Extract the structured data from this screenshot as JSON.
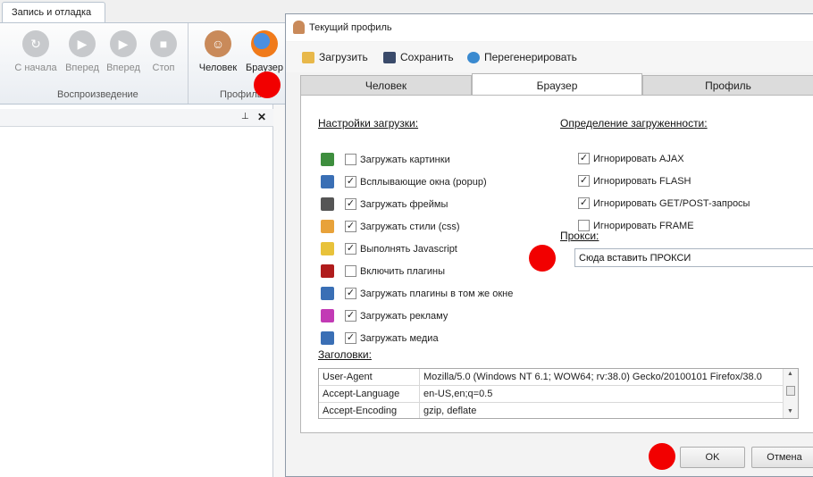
{
  "app": {
    "ribbon_tab": "Запись и отладка",
    "buttons": [
      {
        "label": "С начала",
        "icon": "restart-icon"
      },
      {
        "label": "Вперед",
        "icon": "play-icon"
      },
      {
        "label": "Вперед",
        "icon": "step-forward-icon"
      },
      {
        "label": "Стоп",
        "icon": "stop-icon"
      },
      {
        "label": "Человек",
        "icon": "person-icon"
      },
      {
        "label": "Браузер",
        "icon": "firefox-icon"
      }
    ],
    "group_playback": "Воспроизведение",
    "group_profile": "Профиль",
    "panel_pin": "⊥",
    "panel_close": "✕"
  },
  "dialog": {
    "title": "Текущий профиль",
    "toolbar": {
      "load": "Загрузить",
      "save": "Сохранить",
      "regenerate": "Перегенерировать"
    },
    "tabs": [
      "Человек",
      "Браузер",
      "Профиль"
    ],
    "active_tab": "Браузер",
    "load_settings": {
      "title": "Настройки загрузки:",
      "options": [
        {
          "label": "Загружать картинки",
          "checked": false,
          "icon": "image-icon",
          "color": "#3e8e3e"
        },
        {
          "label": "Всплывающие окна (popup)",
          "checked": true,
          "icon": "popup-icon",
          "color": "#3a6fb5"
        },
        {
          "label": "Загружать фреймы",
          "checked": true,
          "icon": "frames-icon",
          "color": "#555555"
        },
        {
          "label": "Загружать стили (css)",
          "checked": true,
          "icon": "css-icon",
          "color": "#e8a23a"
        },
        {
          "label": "Выполнять Javascript",
          "checked": true,
          "icon": "lightning-icon",
          "color": "#e8c23a"
        },
        {
          "label": "Включить плагины",
          "checked": false,
          "icon": "flash-icon",
          "color": "#b01c1c"
        },
        {
          "label": "Загружать плагины в том же окне",
          "checked": true,
          "icon": "monitor-icon",
          "color": "#3a6fb5"
        },
        {
          "label": "Загружать рекламу",
          "checked": true,
          "icon": "ad-icon",
          "color": "#c23ab5"
        },
        {
          "label": "Загружать медиа",
          "checked": true,
          "icon": "music-icon",
          "color": "#3a6fb5"
        }
      ]
    },
    "load_detection": {
      "title": "Определение загруженности:",
      "options": [
        {
          "label": "Игнорировать AJAX",
          "checked": true
        },
        {
          "label": "Игнорировать FLASH",
          "checked": true
        },
        {
          "label": "Игнорировать GET/POST-запросы",
          "checked": true
        },
        {
          "label": "Игнорировать FRAME",
          "checked": false
        }
      ]
    },
    "proxy": {
      "title": "Прокси:",
      "value": "Сюда вставить ПРОКСИ"
    },
    "headers": {
      "title": "Заголовки:",
      "rows": [
        {
          "key": "User-Agent",
          "value": "Mozilla/5.0 (Windows NT 6.1; WOW64; rv:38.0) Gecko/20100101 Firefox/38.0"
        },
        {
          "key": "Accept-Language",
          "value": "en-US,en;q=0.5"
        },
        {
          "key": "Accept-Encoding",
          "value": "gzip, deflate"
        }
      ]
    },
    "ok": "OK",
    "cancel": "Отмена"
  },
  "colors": {
    "marker": "#f20000",
    "accent": "#3a6fb5"
  }
}
